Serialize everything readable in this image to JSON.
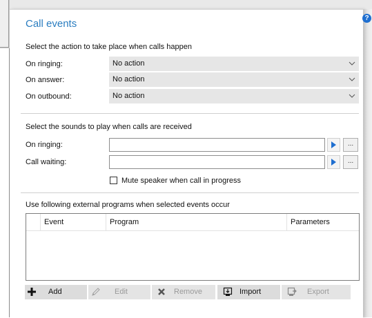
{
  "section_title": "Call events",
  "actions": {
    "heading": "Select the action to take place when calls happen",
    "rows": [
      {
        "label": "On ringing:",
        "value": "No action"
      },
      {
        "label": "On answer:",
        "value": "No action"
      },
      {
        "label": "On outbound:",
        "value": "No action"
      }
    ]
  },
  "sounds": {
    "heading": "Select the sounds to play when calls are received",
    "rows": [
      {
        "label": "On ringing:",
        "value": ""
      },
      {
        "label": "Call waiting:",
        "value": ""
      }
    ],
    "browse_label": "...",
    "mute_label": "Mute speaker when call in progress",
    "mute_checked": false
  },
  "programs": {
    "heading": "Use following external programs when selected events occur",
    "columns": [
      "Event",
      "Program",
      "Parameters"
    ],
    "rows": []
  },
  "toolbar": {
    "add": "Add",
    "edit": "Edit",
    "remove": "Remove",
    "import": "Import",
    "export": "Export"
  },
  "help_label": "?",
  "colors": {
    "title": "#2a7dc0",
    "accent": "#1f6fd0",
    "select_bg": "#e6e6e6",
    "button_bg": "#dcdcdc"
  },
  "icons": {
    "help": "question-circle-icon",
    "dropdown": "chevron-down-icon",
    "play": "play-icon",
    "add": "plus-icon",
    "edit": "pencil-icon",
    "remove": "x-icon",
    "import": "import-icon",
    "export": "export-icon"
  }
}
